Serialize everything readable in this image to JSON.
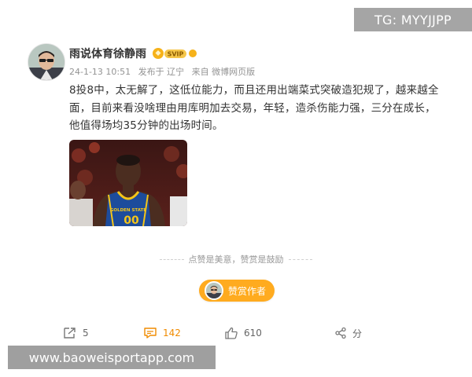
{
  "watermark_top": "TG: MYYJJPP",
  "watermark_bottom": "www.baoweisportapp.com",
  "post": {
    "author": "雨说体育徐静雨",
    "meta": {
      "date": "24-1-13 10:51",
      "location": "发布于 辽宁",
      "source": "来自 微博网页版"
    },
    "text": "8投8中，太无解了，这低位能力，而且还用出端菜式突破造犯规了，越来越全面，目前来看没啥理由用库明加去交易，年轻，造杀伤能力强，三分在成长，他值得场均35分钟的出场时间。",
    "image": {
      "jersey_text": "GOLDEN STATE",
      "jersey_number": "00"
    }
  },
  "reward": {
    "prompt": "点赞是美意，赞赏是鼓励",
    "button_label": "赞赏作者"
  },
  "actions": {
    "repost_count": "5",
    "comment_count": "142",
    "like_count": "610",
    "share_label": "分"
  },
  "colors": {
    "accent_orange": "#f08b00",
    "reward_button": "#ffab1f",
    "text_main": "#333333",
    "text_meta": "#939393"
  }
}
